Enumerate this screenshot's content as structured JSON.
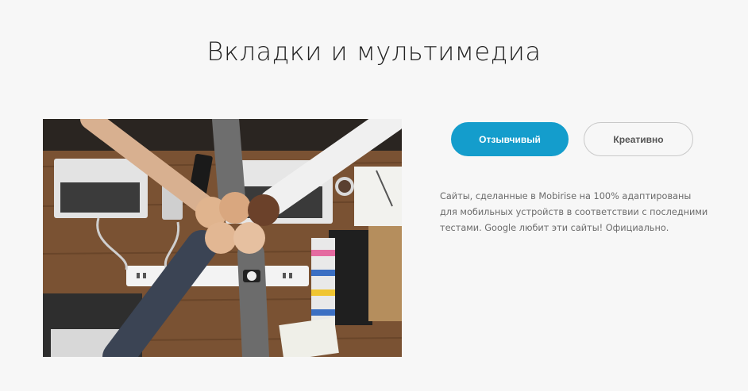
{
  "section": {
    "title": "Вкладки и мультимедиа"
  },
  "tabs": [
    {
      "label": "Отзывчивый",
      "active": true
    },
    {
      "label": "Креативно",
      "active": false
    }
  ],
  "tab_content": {
    "text": "Сайты, сделанные в Mobirise на 100% адаптированы для мобильных устройств в соответствии с последними тестами. Google любит эти сайты! Официально."
  },
  "colors": {
    "background": "#f7f7f7",
    "accent": "#149dcc",
    "title": "#232323",
    "body_text": "#6b6b6b",
    "inactive_border": "#c9c9c9"
  },
  "media": {
    "image_subject": "team-fist-bump-photo"
  }
}
